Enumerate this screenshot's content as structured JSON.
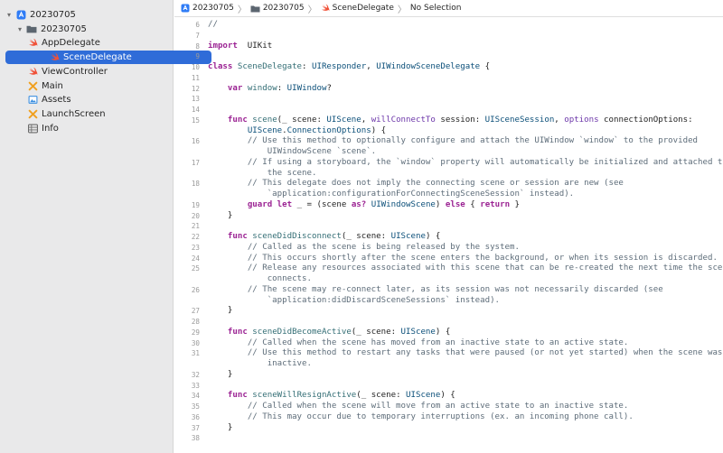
{
  "navigator": {
    "items": [
      {
        "label": "20230705",
        "icon": "xcode-project-icon",
        "indent": 0,
        "disclosure": "▾",
        "selected": false
      },
      {
        "label": "20230705",
        "icon": "folder-icon",
        "indent": 1,
        "disclosure": "▾",
        "selected": false
      },
      {
        "label": "AppDelegate",
        "icon": "swift-file-icon",
        "indent": 2,
        "disclosure": "",
        "selected": false
      },
      {
        "label": "SceneDelegate",
        "icon": "swift-file-icon",
        "indent": 2,
        "disclosure": "",
        "selected": true
      },
      {
        "label": "ViewController",
        "icon": "swift-file-icon",
        "indent": 2,
        "disclosure": "",
        "selected": false
      },
      {
        "label": "Main",
        "icon": "storyboard-icon",
        "indent": 2,
        "disclosure": "",
        "selected": false
      },
      {
        "label": "Assets",
        "icon": "asset-catalog-icon",
        "indent": 2,
        "disclosure": "",
        "selected": false
      },
      {
        "label": "LaunchScreen",
        "icon": "storyboard-icon",
        "indent": 2,
        "disclosure": "",
        "selected": false
      },
      {
        "label": "Info",
        "icon": "plist-icon",
        "indent": 2,
        "disclosure": "",
        "selected": false
      }
    ]
  },
  "jumpbar": {
    "project": "20230705",
    "group": "20230705",
    "file": "SceneDelegate",
    "selection": "No Selection"
  },
  "colors": {
    "keyword": "#9b2393",
    "type": "#0b4f79",
    "function": "#326d74",
    "comment": "#5d6c79",
    "selection": "#2f6cd8",
    "swift_orange": "#f05138"
  },
  "code": {
    "lines": [
      {
        "n": "6",
        "segs": [
          [
            "cm",
            "//"
          ]
        ]
      },
      {
        "n": "7",
        "segs": []
      },
      {
        "n": "8",
        "segs": [
          [
            "kw",
            "import"
          ],
          [
            "",
            "  UIKit"
          ]
        ]
      },
      {
        "n": "9",
        "segs": []
      },
      {
        "n": "10",
        "segs": [
          [
            "kw",
            "class"
          ],
          [
            "",
            " "
          ],
          [
            "fn",
            "SceneDelegate"
          ],
          [
            "",
            ": "
          ],
          [
            "ty",
            "UIResponder"
          ],
          [
            "",
            ", "
          ],
          [
            "ty",
            "UIWindowSceneDelegate"
          ],
          [
            "",
            " {"
          ]
        ]
      },
      {
        "n": "11",
        "segs": []
      },
      {
        "n": "12",
        "segs": [
          [
            "",
            "    "
          ],
          [
            "kw",
            "var"
          ],
          [
            "",
            " "
          ],
          [
            "fn",
            "window"
          ],
          [
            "",
            ": "
          ],
          [
            "ty",
            "UIWindow"
          ],
          [
            "",
            "?"
          ]
        ]
      },
      {
        "n": "13",
        "segs": []
      },
      {
        "n": "14",
        "segs": []
      },
      {
        "n": "15",
        "segs": [
          [
            "",
            "    "
          ],
          [
            "kw",
            "func"
          ],
          [
            "",
            " "
          ],
          [
            "fn",
            "scene"
          ],
          [
            "",
            "(_ scene: "
          ],
          [
            "ty",
            "UIScene"
          ],
          [
            "",
            ", "
          ],
          [
            "pm",
            "willConnectTo"
          ],
          [
            "",
            " session: "
          ],
          [
            "ty",
            "UISceneSession"
          ],
          [
            "",
            ", "
          ],
          [
            "pm",
            "options"
          ],
          [
            "",
            " connectionOptions:"
          ]
        ]
      },
      {
        "n": "",
        "segs": [
          [
            "",
            "        "
          ],
          [
            "ty",
            "UIScene"
          ],
          [
            "",
            "."
          ],
          [
            "ty",
            "ConnectionOptions"
          ],
          [
            "",
            ") {"
          ]
        ]
      },
      {
        "n": "16",
        "segs": [
          [
            "",
            "        "
          ],
          [
            "cm",
            "// Use this method to optionally configure and attach the UIWindow `window` to the provided"
          ]
        ]
      },
      {
        "n": "",
        "segs": [
          [
            "",
            "            "
          ],
          [
            "cm",
            "UIWindowScene `scene`."
          ]
        ]
      },
      {
        "n": "17",
        "segs": [
          [
            "",
            "        "
          ],
          [
            "cm",
            "// If using a storyboard, the `window` property will automatically be initialized and attached to"
          ]
        ]
      },
      {
        "n": "",
        "segs": [
          [
            "",
            "            "
          ],
          [
            "cm",
            "the scene."
          ]
        ]
      },
      {
        "n": "18",
        "segs": [
          [
            "",
            "        "
          ],
          [
            "cm",
            "// This delegate does not imply the connecting scene or session are new (see"
          ]
        ]
      },
      {
        "n": "",
        "segs": [
          [
            "",
            "            "
          ],
          [
            "cm",
            "`application:configurationForConnectingSceneSession` instead)."
          ]
        ]
      },
      {
        "n": "19",
        "segs": [
          [
            "",
            "        "
          ],
          [
            "kw",
            "guard"
          ],
          [
            "",
            " "
          ],
          [
            "kw",
            "let"
          ],
          [
            "",
            " _ = (scene "
          ],
          [
            "kw",
            "as?"
          ],
          [
            "",
            " "
          ],
          [
            "ty",
            "UIWindowScene"
          ],
          [
            "",
            ") "
          ],
          [
            "kw",
            "else"
          ],
          [
            "",
            " { "
          ],
          [
            "kw",
            "return"
          ],
          [
            "",
            " }"
          ]
        ]
      },
      {
        "n": "20",
        "segs": [
          [
            "",
            "    }"
          ]
        ]
      },
      {
        "n": "21",
        "segs": []
      },
      {
        "n": "22",
        "segs": [
          [
            "",
            "    "
          ],
          [
            "kw",
            "func"
          ],
          [
            "",
            " "
          ],
          [
            "fn",
            "sceneDidDisconnect"
          ],
          [
            "",
            "(_ scene: "
          ],
          [
            "ty",
            "UIScene"
          ],
          [
            "",
            ") {"
          ]
        ]
      },
      {
        "n": "23",
        "segs": [
          [
            "",
            "        "
          ],
          [
            "cm",
            "// Called as the scene is being released by the system."
          ]
        ]
      },
      {
        "n": "24",
        "segs": [
          [
            "",
            "        "
          ],
          [
            "cm",
            "// This occurs shortly after the scene enters the background, or when its session is discarded."
          ]
        ]
      },
      {
        "n": "25",
        "segs": [
          [
            "",
            "        "
          ],
          [
            "cm",
            "// Release any resources associated with this scene that can be re-created the next time the scene"
          ]
        ]
      },
      {
        "n": "",
        "segs": [
          [
            "",
            "            "
          ],
          [
            "cm",
            "connects."
          ]
        ]
      },
      {
        "n": "26",
        "segs": [
          [
            "",
            "        "
          ],
          [
            "cm",
            "// The scene may re-connect later, as its session was not necessarily discarded (see"
          ]
        ]
      },
      {
        "n": "",
        "segs": [
          [
            "",
            "            "
          ],
          [
            "cm",
            "`application:didDiscardSceneSessions` instead)."
          ]
        ]
      },
      {
        "n": "27",
        "segs": [
          [
            "",
            "    }"
          ]
        ]
      },
      {
        "n": "28",
        "segs": []
      },
      {
        "n": "29",
        "segs": [
          [
            "",
            "    "
          ],
          [
            "kw",
            "func"
          ],
          [
            "",
            " "
          ],
          [
            "fn",
            "sceneDidBecomeActive"
          ],
          [
            "",
            "(_ scene: "
          ],
          [
            "ty",
            "UIScene"
          ],
          [
            "",
            ") {"
          ]
        ]
      },
      {
        "n": "30",
        "segs": [
          [
            "",
            "        "
          ],
          [
            "cm",
            "// Called when the scene has moved from an inactive state to an active state."
          ]
        ]
      },
      {
        "n": "31",
        "segs": [
          [
            "",
            "        "
          ],
          [
            "cm",
            "// Use this method to restart any tasks that were paused (or not yet started) when the scene was"
          ]
        ]
      },
      {
        "n": "",
        "segs": [
          [
            "",
            "            "
          ],
          [
            "cm",
            "inactive."
          ]
        ]
      },
      {
        "n": "32",
        "segs": [
          [
            "",
            "    }"
          ]
        ]
      },
      {
        "n": "33",
        "segs": []
      },
      {
        "n": "34",
        "segs": [
          [
            "",
            "    "
          ],
          [
            "kw",
            "func"
          ],
          [
            "",
            " "
          ],
          [
            "fn",
            "sceneWillResignActive"
          ],
          [
            "",
            "(_ scene: "
          ],
          [
            "ty",
            "UIScene"
          ],
          [
            "",
            ") {"
          ]
        ]
      },
      {
        "n": "35",
        "segs": [
          [
            "",
            "        "
          ],
          [
            "cm",
            "// Called when the scene will move from an active state to an inactive state."
          ]
        ]
      },
      {
        "n": "36",
        "segs": [
          [
            "",
            "        "
          ],
          [
            "cm",
            "// This may occur due to temporary interruptions (ex. an incoming phone call)."
          ]
        ]
      },
      {
        "n": "37",
        "segs": [
          [
            "",
            "    }"
          ]
        ]
      },
      {
        "n": "38",
        "segs": []
      }
    ]
  }
}
